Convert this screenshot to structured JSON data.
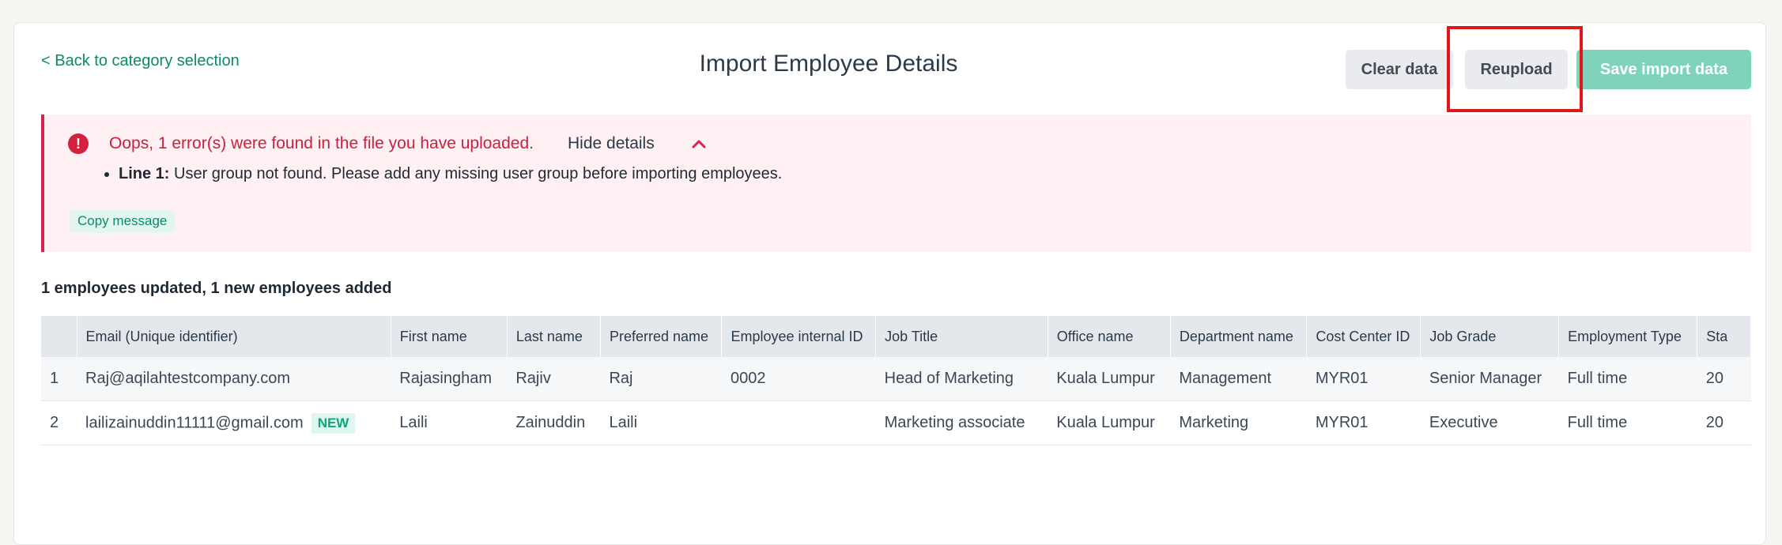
{
  "header": {
    "back_link": "< Back to category selection",
    "title": "Import Employee Details",
    "buttons": {
      "clear": "Clear data",
      "reupload": "Reupload",
      "save": "Save import data"
    }
  },
  "alert": {
    "title": "Oops, 1 error(s) were found in the file you have uploaded.",
    "hide_details": "Hide details",
    "errors": [
      {
        "line": "Line 1:",
        "message": "User group not found. Please add any missing user group before importing employees."
      }
    ],
    "copy_label": "Copy message"
  },
  "summary": "1 employees updated, 1 new employees added",
  "table": {
    "columns": [
      "",
      "Email (Unique identifier)",
      "First name",
      "Last name",
      "Preferred name",
      "Employee internal ID",
      "Job Title",
      "Office name",
      "Department name",
      "Cost Center ID",
      "Job Grade",
      "Employment Type",
      "Sta"
    ],
    "rows": [
      {
        "num": "1",
        "email": "Raj@aqilahtestcompany.com",
        "badge": "",
        "first": "Rajasingham",
        "last": "Rajiv",
        "preferred": "Raj",
        "internal_id": "0002",
        "job_title": "Head of Marketing",
        "office": "Kuala Lumpur",
        "department": "Management",
        "cost_center": "MYR01",
        "grade": "Senior Manager",
        "type": "Full time",
        "start": "20"
      },
      {
        "num": "2",
        "email": "lailizainuddin11111@gmail.com",
        "badge": "NEW",
        "first": "Laili",
        "last": "Zainuddin",
        "preferred": "Laili",
        "internal_id": "",
        "job_title": "Marketing associate",
        "office": "Kuala Lumpur",
        "department": "Marketing",
        "cost_center": "MYR01",
        "grade": "Executive",
        "type": "Full time",
        "start": "20"
      }
    ]
  },
  "colors": {
    "accent": "#0c8a6a",
    "error": "#c9213e",
    "save_disabled": "#7fd3bb",
    "highlight": "#e0161b"
  }
}
